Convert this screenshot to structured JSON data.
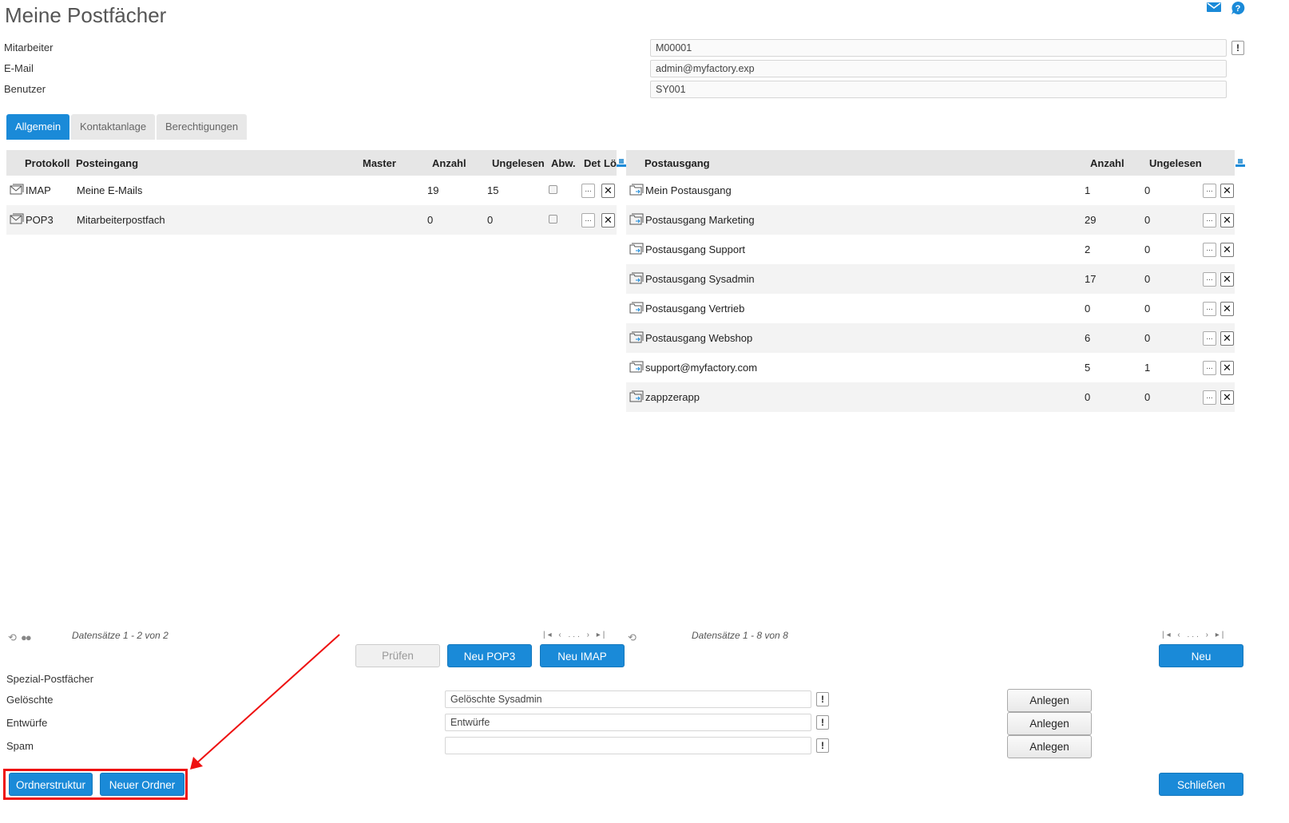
{
  "page": {
    "title": "Meine Postfächer"
  },
  "top_icons": [
    "mail-icon",
    "help-icon"
  ],
  "fields": {
    "mitarbeiter": {
      "label": "Mitarbeiter",
      "value": "M00001"
    },
    "email": {
      "label": "E-Mail",
      "value": "admin@myfactory.exp"
    },
    "benutzer": {
      "label": "Benutzer",
      "value": "SY001"
    }
  },
  "tabs": [
    {
      "label": "Allgemein",
      "active": true
    },
    {
      "label": "Kontaktanlage",
      "active": false
    },
    {
      "label": "Berechtigungen",
      "active": false
    }
  ],
  "inbox": {
    "headers": {
      "protokoll": "Protokoll",
      "posteingang": "Posteingang",
      "master": "Master",
      "anzahl": "Anzahl",
      "ungelesen": "Ungelesen",
      "abw": "Abw.",
      "det": "Det",
      "lo": "Lö"
    },
    "rows": [
      {
        "protokoll": "IMAP",
        "posteingang": "Meine E-Mails",
        "anzahl": "19",
        "ungelesen": "15",
        "abw": false
      },
      {
        "protokoll": "POP3",
        "posteingang": "Mitarbeiterpostfach",
        "anzahl": "0",
        "ungelesen": "0",
        "abw": false
      }
    ],
    "pager": {
      "info": "Datensätze 1 - 2 von 2",
      "ellipsis": "..."
    }
  },
  "outbox": {
    "headers": {
      "postausgang": "Postausgang",
      "anzahl": "Anzahl",
      "ungelesen": "Ungelesen"
    },
    "rows": [
      {
        "name": "Mein Postausgang",
        "anzahl": "1",
        "ungelesen": "0"
      },
      {
        "name": "Postausgang Marketing",
        "anzahl": "29",
        "ungelesen": "0"
      },
      {
        "name": "Postausgang Support",
        "anzahl": "2",
        "ungelesen": "0"
      },
      {
        "name": "Postausgang Sysadmin",
        "anzahl": "17",
        "ungelesen": "0"
      },
      {
        "name": "Postausgang Vertrieb",
        "anzahl": "0",
        "ungelesen": "0"
      },
      {
        "name": "Postausgang Webshop",
        "anzahl": "6",
        "ungelesen": "0"
      },
      {
        "name": "support@myfactory.com",
        "anzahl": "5",
        "ungelesen": "1"
      },
      {
        "name": "zappzerapp",
        "anzahl": "0",
        "ungelesen": "0"
      }
    ],
    "pager": {
      "info": "Datensätze 1 - 8 von 8",
      "ellipsis": "..."
    }
  },
  "row_buttons": {
    "details": "...",
    "delete": "✕"
  },
  "buttons": {
    "pruefen": "Prüfen",
    "neu_pop3": "Neu POP3",
    "neu_imap": "Neu IMAP",
    "neu": "Neu",
    "ordnerstruktur": "Ordnerstruktur",
    "neuer_ordner": "Neuer Ordner",
    "schliessen": "Schließen"
  },
  "spezial": {
    "heading": "Spezial-Postfächer",
    "items": [
      {
        "label": "Gelöschte",
        "value": "Gelöschte Sysadmin",
        "button": "Anlegen"
      },
      {
        "label": "Entwürfe",
        "value": "Entwürfe",
        "button": "Anlegen"
      },
      {
        "label": "Spam",
        "value": "",
        "button": "Anlegen"
      }
    ]
  },
  "colors": {
    "accent": "#1a8ad8",
    "highlight": "#ee1111"
  }
}
